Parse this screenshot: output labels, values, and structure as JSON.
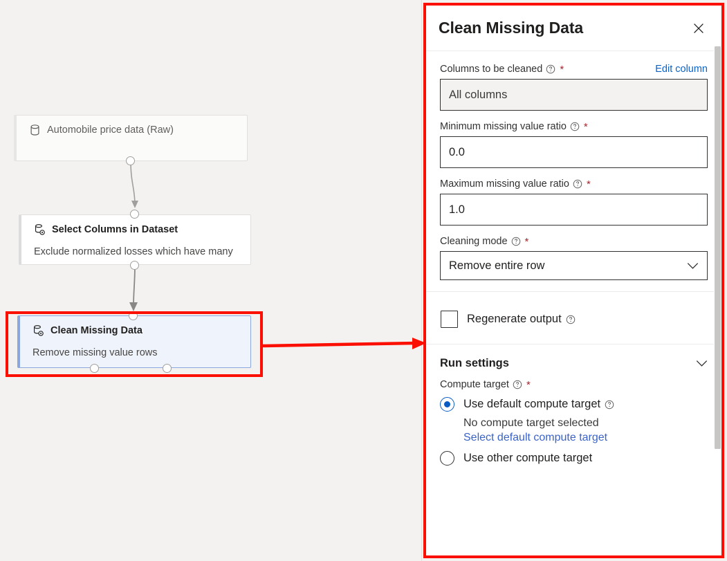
{
  "canvas": {
    "nodes": [
      {
        "id": "automobile-price-data-raw",
        "title": "Automobile price data (Raw)",
        "comment": "",
        "icon": "dataset-cylinder-icon",
        "kind": "dataset",
        "selected": false
      },
      {
        "id": "select-columns-in-dataset",
        "title": "Select Columns in Dataset",
        "comment": "Exclude normalized losses which have many",
        "icon": "module-cylinder-gear-icon",
        "kind": "module",
        "selected": false
      },
      {
        "id": "clean-missing-data",
        "title": "Clean Missing Data",
        "comment": "Remove missing value rows",
        "icon": "module-cylinder-gear-icon",
        "kind": "module",
        "selected": true
      }
    ],
    "annotation": {
      "highlight_color": "#fb0f00",
      "arrow_color": "#fb0f00",
      "highlight_target": "clean-missing-data"
    }
  },
  "panel": {
    "title": "Clean Missing Data",
    "close_icon": "close-icon",
    "border_color": "#fb0f00",
    "fields": [
      {
        "label": "Columns to be cleaned",
        "required": "*",
        "info_icon": "help-circle-icon",
        "action_label": "Edit column",
        "control": "readonly-textbox",
        "value": "All columns"
      },
      {
        "label": "Minimum missing value ratio",
        "required": "*",
        "info_icon": "help-circle-icon",
        "action_label": "",
        "control": "textbox",
        "value": "0.0"
      },
      {
        "label": "Maximum missing value ratio",
        "required": "*",
        "info_icon": "help-circle-icon",
        "action_label": "",
        "control": "textbox",
        "value": "1.0"
      },
      {
        "label": "Cleaning mode",
        "required": "*",
        "info_icon": "help-circle-icon",
        "action_label": "",
        "control": "dropdown",
        "value": "Remove entire row",
        "chevron_icon": "chevron-down-icon"
      }
    ],
    "regenerate": {
      "label": "Regenerate output",
      "info_icon": "help-circle-icon",
      "checked": false
    },
    "run_settings": {
      "title": "Run settings",
      "chevron_icon": "chevron-down-icon",
      "compute_target_label": "Compute target",
      "compute_target_required": "*",
      "compute_target_info_icon": "help-circle-icon",
      "options": [
        {
          "label": "Use default compute target",
          "info_icon": "help-circle-icon",
          "selected": true,
          "status_text": "No compute target selected",
          "link_text": "Select default compute target"
        },
        {
          "label": "Use other compute target",
          "info_icon": "",
          "selected": false,
          "status_text": "",
          "link_text": ""
        }
      ]
    },
    "scrollbar": {
      "thumb_color": "#c8c6c4"
    }
  },
  "colors": {
    "accent_link": "#0a62c9",
    "required_asterisk": "#a4262c",
    "radio_selected": "#0a5cc4",
    "annotation_red": "#fb0f00",
    "canvas_background": "#f3f2f1",
    "selected_node_background": "#eff3fb"
  }
}
